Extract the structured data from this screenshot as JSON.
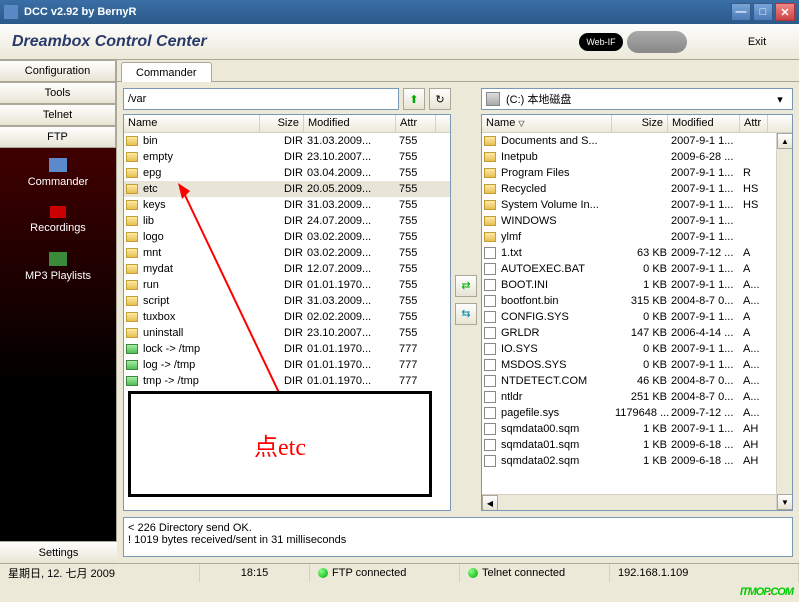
{
  "window": {
    "title": "DCC v2.92 by BernyR"
  },
  "header": {
    "title": "Dreambox Control Center",
    "webif": "Web-IF",
    "exit": "Exit"
  },
  "sidebar": {
    "buttons": [
      "Configuration",
      "Tools",
      "Telnet",
      "FTP"
    ],
    "items": [
      {
        "label": "Commander"
      },
      {
        "label": "Recordings"
      },
      {
        "label": "MP3 Playlists"
      }
    ],
    "settings": "Settings"
  },
  "tabs": [
    "Commander"
  ],
  "leftPane": {
    "path": "/var",
    "columns": {
      "name": "Name",
      "size": "Size",
      "modified": "Modified",
      "attr": "Attr"
    },
    "rows": [
      {
        "icon": "folder",
        "name": "bin",
        "size": "DIR",
        "modified": "31.03.2009...",
        "attr": "755"
      },
      {
        "icon": "folder",
        "name": "empty",
        "size": "DIR",
        "modified": "23.10.2007...",
        "attr": "755"
      },
      {
        "icon": "folder",
        "name": "epg",
        "size": "DIR",
        "modified": "03.04.2009...",
        "attr": "755"
      },
      {
        "icon": "folder",
        "name": "etc",
        "size": "DIR",
        "modified": "20.05.2009...",
        "attr": "755",
        "selected": true
      },
      {
        "icon": "folder",
        "name": "keys",
        "size": "DIR",
        "modified": "31.03.2009...",
        "attr": "755"
      },
      {
        "icon": "folder",
        "name": "lib",
        "size": "DIR",
        "modified": "24.07.2009...",
        "attr": "755"
      },
      {
        "icon": "folder",
        "name": "logo",
        "size": "DIR",
        "modified": "03.02.2009...",
        "attr": "755"
      },
      {
        "icon": "folder",
        "name": "mnt",
        "size": "DIR",
        "modified": "03.02.2009...",
        "attr": "755"
      },
      {
        "icon": "folder",
        "name": "mydat",
        "size": "DIR",
        "modified": "12.07.2009...",
        "attr": "755"
      },
      {
        "icon": "folder",
        "name": "run",
        "size": "DIR",
        "modified": "01.01.1970...",
        "attr": "755"
      },
      {
        "icon": "folder",
        "name": "script",
        "size": "DIR",
        "modified": "31.03.2009...",
        "attr": "755"
      },
      {
        "icon": "folder",
        "name": "tuxbox",
        "size": "DIR",
        "modified": "02.02.2009...",
        "attr": "755"
      },
      {
        "icon": "folder",
        "name": "uninstall",
        "size": "DIR",
        "modified": "23.10.2007...",
        "attr": "755"
      },
      {
        "icon": "link",
        "name": "lock -> /tmp",
        "size": "DIR",
        "modified": "01.01.1970...",
        "attr": "777"
      },
      {
        "icon": "link",
        "name": "log -> /tmp",
        "size": "DIR",
        "modified": "01.01.1970...",
        "attr": "777"
      },
      {
        "icon": "link",
        "name": "tmp -> /tmp",
        "size": "DIR",
        "modified": "01.01.1970...",
        "attr": "777"
      }
    ]
  },
  "rightPane": {
    "drive": "(C:)  本地磁盘",
    "columns": {
      "name": "Name",
      "size": "Size",
      "modified": "Modified",
      "attr": "Attr"
    },
    "rows": [
      {
        "icon": "folder",
        "name": "Documents and S...",
        "size": "",
        "modified": "2007-9-1 1...",
        "attr": ""
      },
      {
        "icon": "folder",
        "name": "Inetpub",
        "size": "",
        "modified": "2009-6-28 ...",
        "attr": ""
      },
      {
        "icon": "folder",
        "name": "Program Files",
        "size": "",
        "modified": "2007-9-1 1...",
        "attr": "R"
      },
      {
        "icon": "folder",
        "name": "Recycled",
        "size": "",
        "modified": "2007-9-1 1...",
        "attr": "HS"
      },
      {
        "icon": "folder",
        "name": "System Volume In...",
        "size": "",
        "modified": "2007-9-1 1...",
        "attr": "HS"
      },
      {
        "icon": "folder",
        "name": "WINDOWS",
        "size": "",
        "modified": "2007-9-1 1...",
        "attr": ""
      },
      {
        "icon": "folder",
        "name": "ylmf",
        "size": "",
        "modified": "2007-9-1 1...",
        "attr": ""
      },
      {
        "icon": "file",
        "name": "1.txt",
        "size": "63 KB",
        "modified": "2009-7-12 ...",
        "attr": "A"
      },
      {
        "icon": "file",
        "name": "AUTOEXEC.BAT",
        "size": "0 KB",
        "modified": "2007-9-1 1...",
        "attr": "A"
      },
      {
        "icon": "file",
        "name": "BOOT.INI",
        "size": "1 KB",
        "modified": "2007-9-1 1...",
        "attr": "A..."
      },
      {
        "icon": "file",
        "name": "bootfont.bin",
        "size": "315 KB",
        "modified": "2004-8-7 0...",
        "attr": "A..."
      },
      {
        "icon": "file",
        "name": "CONFIG.SYS",
        "size": "0 KB",
        "modified": "2007-9-1 1...",
        "attr": "A"
      },
      {
        "icon": "file",
        "name": "GRLDR",
        "size": "147 KB",
        "modified": "2006-4-14 ...",
        "attr": "A"
      },
      {
        "icon": "file",
        "name": "IO.SYS",
        "size": "0 KB",
        "modified": "2007-9-1 1...",
        "attr": "A..."
      },
      {
        "icon": "file",
        "name": "MSDOS.SYS",
        "size": "0 KB",
        "modified": "2007-9-1 1...",
        "attr": "A..."
      },
      {
        "icon": "file",
        "name": "NTDETECT.COM",
        "size": "46 KB",
        "modified": "2004-8-7 0...",
        "attr": "A..."
      },
      {
        "icon": "file",
        "name": "ntldr",
        "size": "251 KB",
        "modified": "2004-8-7 0...",
        "attr": "A..."
      },
      {
        "icon": "file",
        "name": "pagefile.sys",
        "size": "1179648 ...",
        "modified": "2009-7-12 ...",
        "attr": "A..."
      },
      {
        "icon": "file",
        "name": "sqmdata00.sqm",
        "size": "1 KB",
        "modified": "2007-9-1 1...",
        "attr": "AH"
      },
      {
        "icon": "file",
        "name": "sqmdata01.sqm",
        "size": "1 KB",
        "modified": "2009-6-18 ...",
        "attr": "AH"
      },
      {
        "icon": "file",
        "name": "sqmdata02.sqm",
        "size": "1 KB",
        "modified": "2009-6-18 ...",
        "attr": "AH"
      }
    ]
  },
  "annotation": {
    "text": "点etc"
  },
  "log": {
    "line1": "< 226 Directory send OK.",
    "line2": "! 1019 bytes received/sent in 31 milliseconds"
  },
  "status": {
    "date": "星期日, 12. 七月 2009",
    "time": "18:15",
    "ftp": "FTP connected",
    "telnet": "Telnet connected",
    "ip": "192.168.1.109"
  },
  "watermark": {
    "a": "ITMOP",
    "b": ".",
    "c": "COM"
  }
}
